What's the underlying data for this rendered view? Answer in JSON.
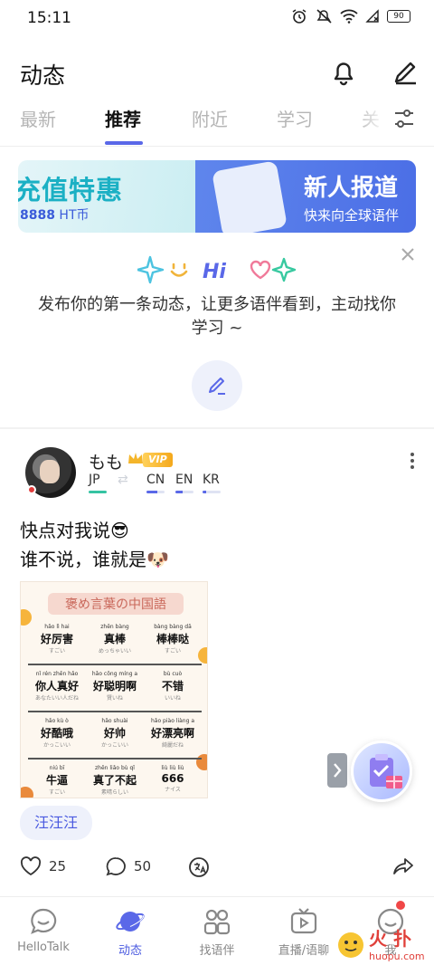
{
  "status_bar": {
    "time": "15:11",
    "battery": "90",
    "icons": [
      "alarm-icon",
      "mute-icon",
      "wifi-icon",
      "signal-off-icon",
      "battery-icon"
    ]
  },
  "header": {
    "title": "动态",
    "icons": [
      "bell-icon",
      "pen-icon"
    ]
  },
  "tabs": {
    "items": [
      {
        "label": "最新",
        "active": false
      },
      {
        "label": "推荐",
        "active": true
      },
      {
        "label": "附近",
        "active": false
      },
      {
        "label": "学习",
        "active": false
      },
      {
        "label": "关",
        "active": false
      }
    ],
    "accent": "#5a68e8"
  },
  "banner": {
    "left_title": "充值特惠",
    "left_amount": "8888",
    "left_unit": "HT币",
    "right_title": "新人报道",
    "right_subtitle": "快来向全球语伴"
  },
  "prompt": {
    "deco_text": "Hi",
    "text": "发布你的第一条动态，让更多语伴看到，主动找你学习 ~"
  },
  "post": {
    "user": {
      "name": "もも",
      "badge": "VIP",
      "native": {
        "code": "JP",
        "color": "#35c3a2"
      },
      "learning": [
        {
          "code": "CN",
          "color": "#5a68e8"
        },
        {
          "code": "EN",
          "color": "#5a68e8"
        },
        {
          "code": "KR",
          "color": "#5a68e8"
        }
      ]
    },
    "lines": [
      "快点对我说😎",
      "谁不说，谁就是🐶"
    ],
    "image": {
      "title": "褒め言葉の中国語",
      "rows": [
        [
          {
            "py": "hǎo lì hai",
            "zh": "好厉害",
            "jp": "すごい"
          },
          {
            "py": "zhēn bàng",
            "zh": "真棒",
            "jp": "めっちゃいい"
          },
          {
            "py": "bàng bàng dā",
            "zh": "棒棒哒",
            "jp": "すごい"
          }
        ],
        [
          {
            "py": "nǐ rén zhēn hǎo",
            "zh": "你人真好",
            "jp": "あなたいい人だね"
          },
          {
            "py": "hǎo cōng míng a",
            "zh": "好聪明啊",
            "jp": "賢いね"
          },
          {
            "py": "bù cuò",
            "zh": "不错",
            "jp": "いいね"
          }
        ],
        [
          {
            "py": "hǎo kù ò",
            "zh": "好酷哦",
            "jp": "かっこいい"
          },
          {
            "py": "hǎo shuài",
            "zh": "好帅",
            "jp": "かっこいい"
          },
          {
            "py": "hǎo piào liàng a",
            "zh": "好漂亮啊",
            "jp": "綺麗だね"
          }
        ],
        [
          {
            "py": "niú bī",
            "zh": "牛逼",
            "jp": "すごい"
          },
          {
            "py": "zhēn liǎo bù qǐ",
            "zh": "真了不起",
            "jp": "素晴らしい"
          },
          {
            "py": "liù liù liù",
            "zh": "666",
            "jp": "ナイス"
          }
        ]
      ]
    },
    "tag": "汪汪汪",
    "likes": "25",
    "comments": "50"
  },
  "bottom_nav": {
    "items": [
      {
        "label": "HelloTalk",
        "icon": "chat-bubble-icon",
        "active": false
      },
      {
        "label": "动态",
        "icon": "planet-icon",
        "active": true
      },
      {
        "label": "找语伴",
        "icon": "people-icon",
        "active": false
      },
      {
        "label": "直播/语聊",
        "icon": "tv-icon",
        "active": false
      },
      {
        "label": "我",
        "icon": "profile-icon",
        "active": false
      }
    ]
  },
  "watermark": "huopu.com"
}
